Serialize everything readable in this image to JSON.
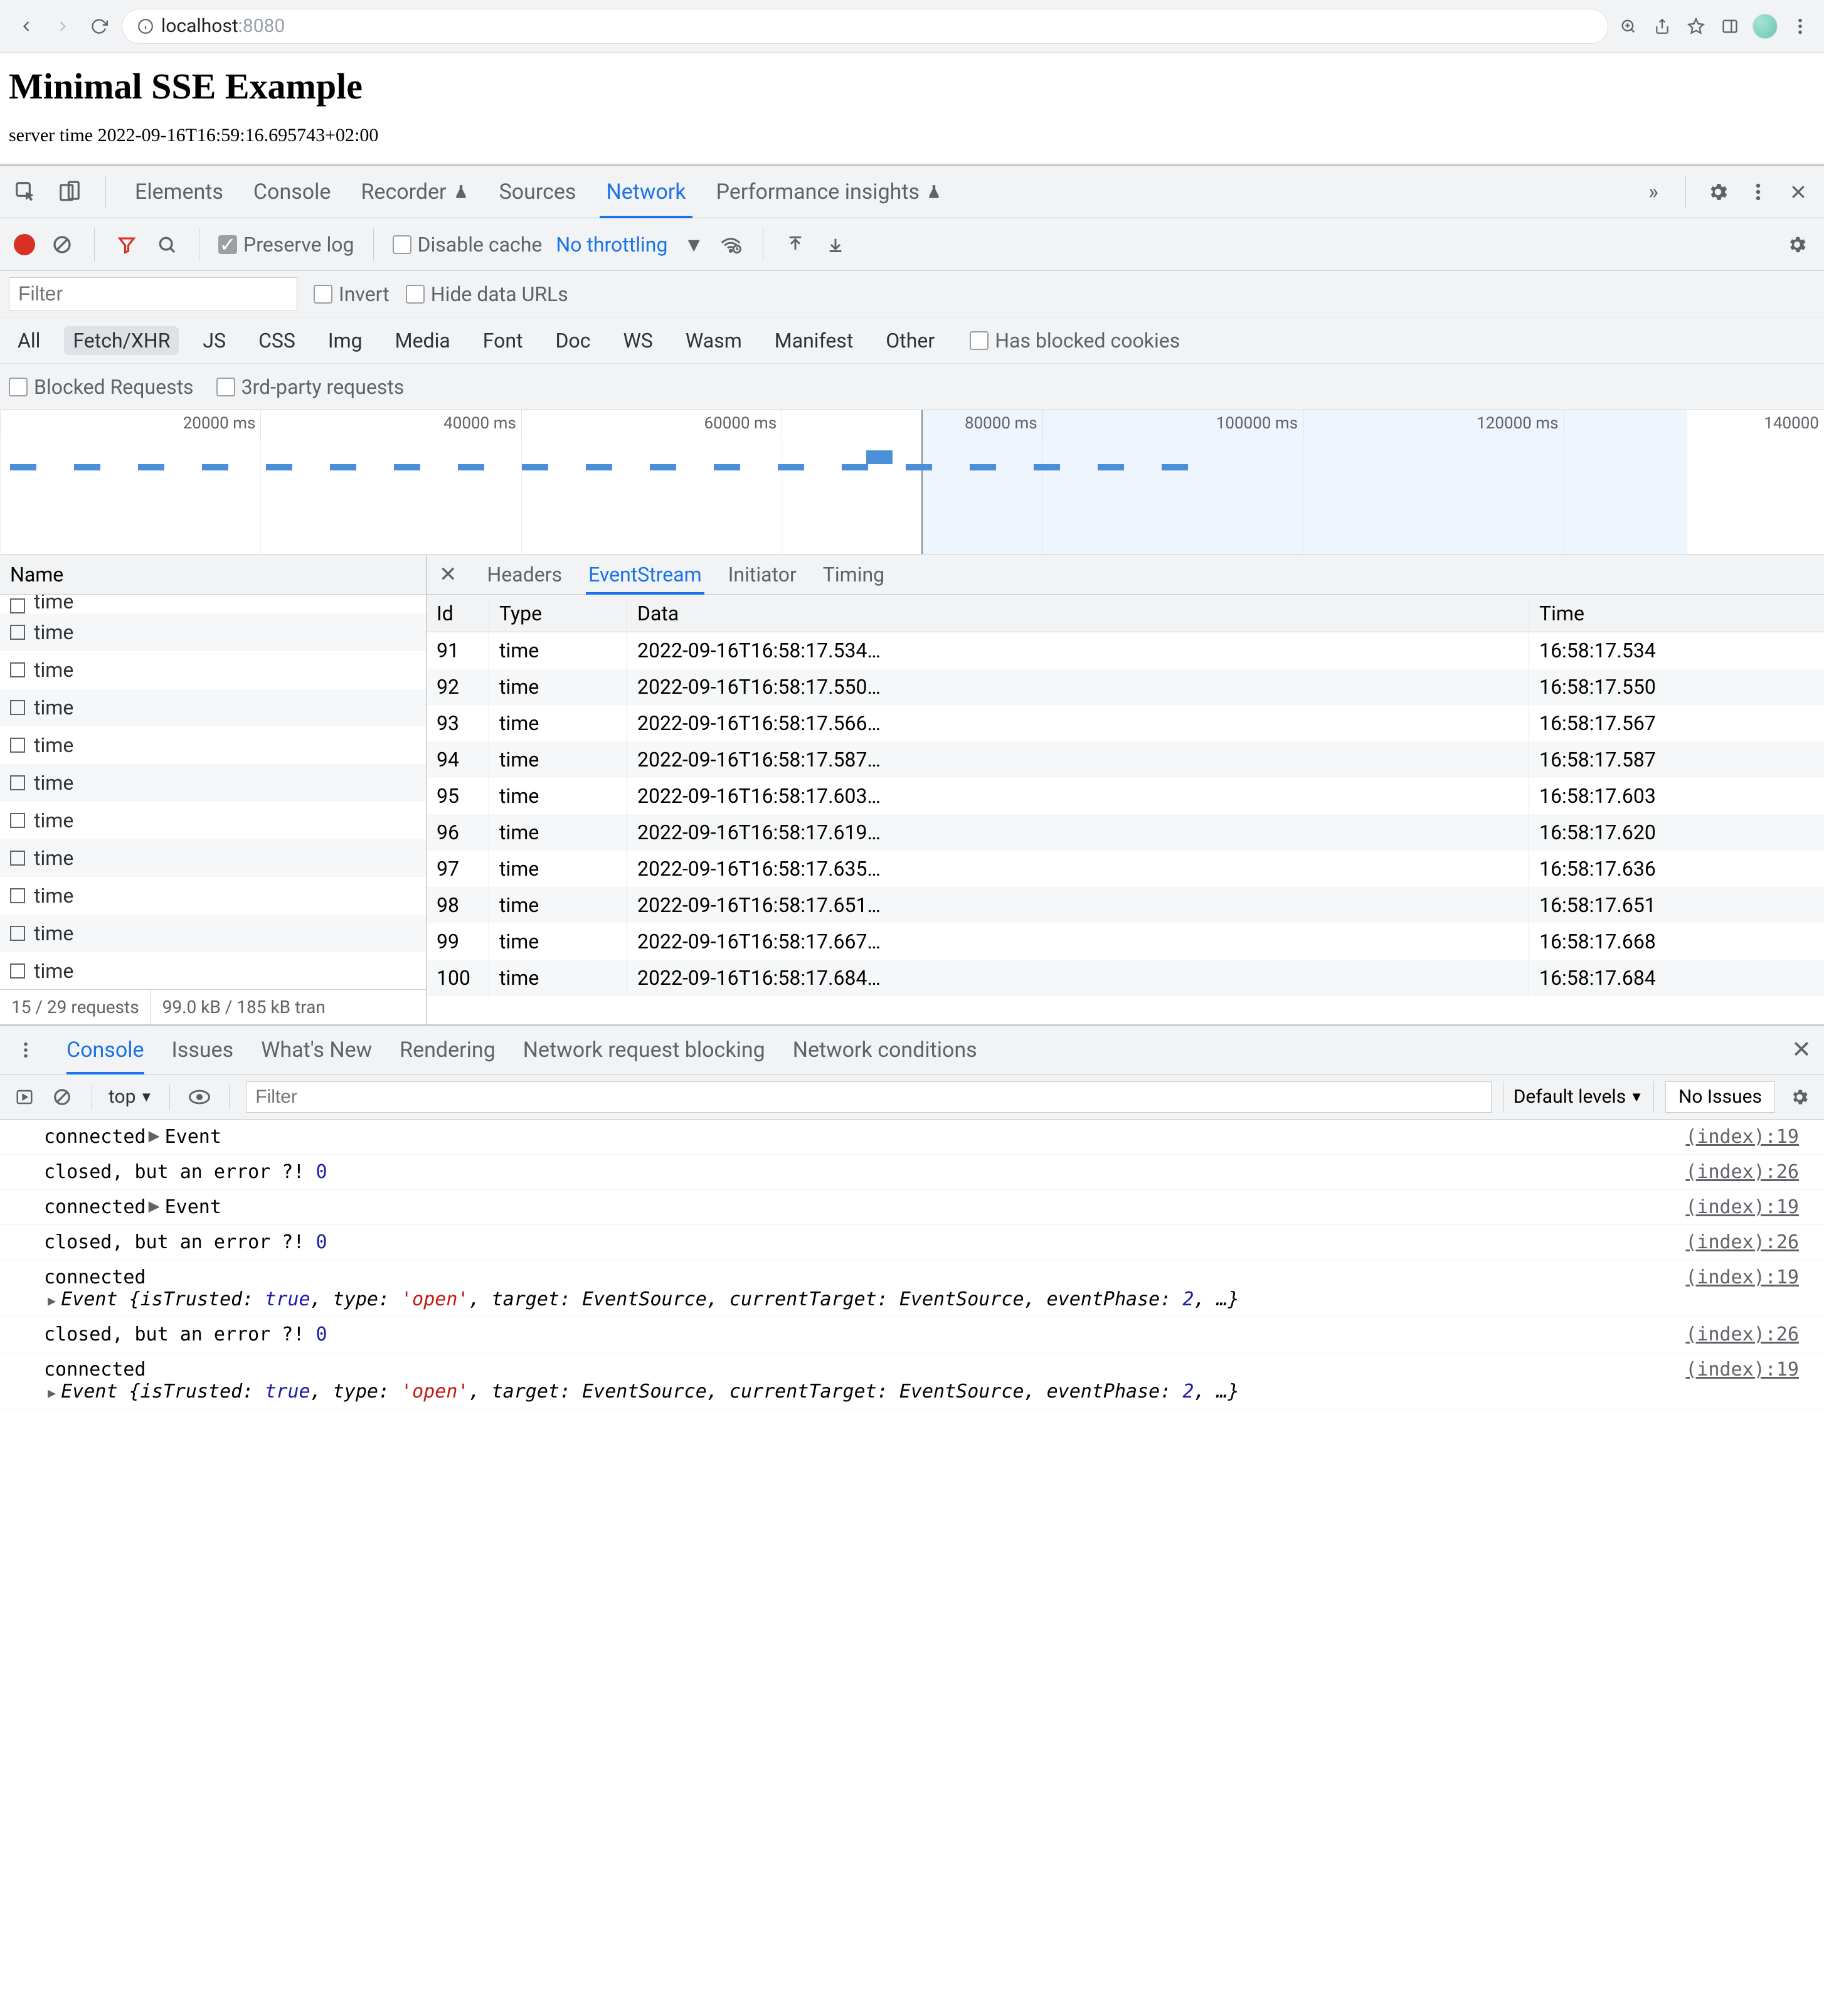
{
  "browser": {
    "address_host": "localhost",
    "address_port": ":8080"
  },
  "page": {
    "h1": "Minimal SSE Example",
    "server_time_prefix": "server time ",
    "server_time": "2022-09-16T16:59:16.695743+02:00"
  },
  "devtools": {
    "tabs": [
      "Elements",
      "Console",
      "Recorder",
      "Sources",
      "Network",
      "Performance insights"
    ],
    "active_tab": "Network",
    "more_sym": "»"
  },
  "network": {
    "preserve_log_label": "Preserve log",
    "disable_cache_label": "Disable cache",
    "throttling": "No throttling",
    "filter_placeholder": "Filter",
    "invert_label": "Invert",
    "hide_urls_label": "Hide data URLs",
    "type_filters": [
      "All",
      "Fetch/XHR",
      "JS",
      "CSS",
      "Img",
      "Media",
      "Font",
      "Doc",
      "WS",
      "Wasm",
      "Manifest",
      "Other"
    ],
    "active_type_filter": "Fetch/XHR",
    "blocked_cookies_label": "Has blocked cookies",
    "blocked_req_label": "Blocked Requests",
    "third_party_label": "3rd-party requests",
    "waterfall_ticks": [
      "20000 ms",
      "40000 ms",
      "60000 ms",
      "80000 ms",
      "100000 ms",
      "120000 ms",
      "140000"
    ]
  },
  "requests": {
    "name_col": "Name",
    "item_label": "time",
    "foot_left": "15 / 29 requests",
    "foot_right": "99.0 kB / 185 kB tran"
  },
  "detail": {
    "tabs": [
      "Headers",
      "EventStream",
      "Initiator",
      "Timing"
    ],
    "active_tab": "EventStream",
    "cols": {
      "id": "Id",
      "type": "Type",
      "data": "Data",
      "time": "Time"
    },
    "rows": [
      {
        "id": "91",
        "type": "time",
        "data": "2022-09-16T16:58:17.534…",
        "time": "16:58:17.534"
      },
      {
        "id": "92",
        "type": "time",
        "data": "2022-09-16T16:58:17.550…",
        "time": "16:58:17.550"
      },
      {
        "id": "93",
        "type": "time",
        "data": "2022-09-16T16:58:17.566…",
        "time": "16:58:17.567"
      },
      {
        "id": "94",
        "type": "time",
        "data": "2022-09-16T16:58:17.587…",
        "time": "16:58:17.587"
      },
      {
        "id": "95",
        "type": "time",
        "data": "2022-09-16T16:58:17.603…",
        "time": "16:58:17.603"
      },
      {
        "id": "96",
        "type": "time",
        "data": "2022-09-16T16:58:17.619…",
        "time": "16:58:17.620"
      },
      {
        "id": "97",
        "type": "time",
        "data": "2022-09-16T16:58:17.635…",
        "time": "16:58:17.636"
      },
      {
        "id": "98",
        "type": "time",
        "data": "2022-09-16T16:58:17.651…",
        "time": "16:58:17.651"
      },
      {
        "id": "99",
        "type": "time",
        "data": "2022-09-16T16:58:17.667…",
        "time": "16:58:17.668"
      },
      {
        "id": "100",
        "type": "time",
        "data": "2022-09-16T16:58:17.684…",
        "time": "16:58:17.684"
      }
    ]
  },
  "drawer": {
    "tabs": [
      "Console",
      "Issues",
      "What's New",
      "Rendering",
      "Network request blocking",
      "Network conditions"
    ],
    "active_tab": "Console",
    "context": "top",
    "filter_placeholder": "Filter",
    "levels": "Default levels",
    "no_issues": "No Issues"
  },
  "console_logs": [
    {
      "kind": "event",
      "msg": "connected",
      "has_event": true,
      "obj": "Event",
      "src": "(index):19"
    },
    {
      "kind": "plain",
      "msg": "closed, but an error ?! ",
      "num": "0",
      "src": "(index):26"
    },
    {
      "kind": "event",
      "msg": "connected",
      "has_event": true,
      "obj": "Event",
      "src": "(index):19"
    },
    {
      "kind": "plain",
      "msg": "closed, but an error ?! ",
      "num": "0",
      "src": "(index):26"
    },
    {
      "kind": "expanded",
      "msg": "connected",
      "expand_pre": "Event {isTrusted: ",
      "v_true": "true",
      "mid1": ", type: ",
      "v_str": "'open'",
      "mid2": ", target: EventSource, currentTarget: EventSource, eventPhase: ",
      "v_num": "2",
      "trail": ", …}",
      "src": "(index):19"
    },
    {
      "kind": "plain",
      "msg": "closed, but an error ?! ",
      "num": "0",
      "src": "(index):26"
    },
    {
      "kind": "expanded",
      "msg": "connected",
      "expand_pre": "Event {isTrusted: ",
      "v_true": "true",
      "mid1": ", type: ",
      "v_str": "'open'",
      "mid2": ", target: EventSource, currentTarget: EventSource, eventPhase: ",
      "v_num": "2",
      "trail": ", …}",
      "src": "(index):19"
    }
  ]
}
